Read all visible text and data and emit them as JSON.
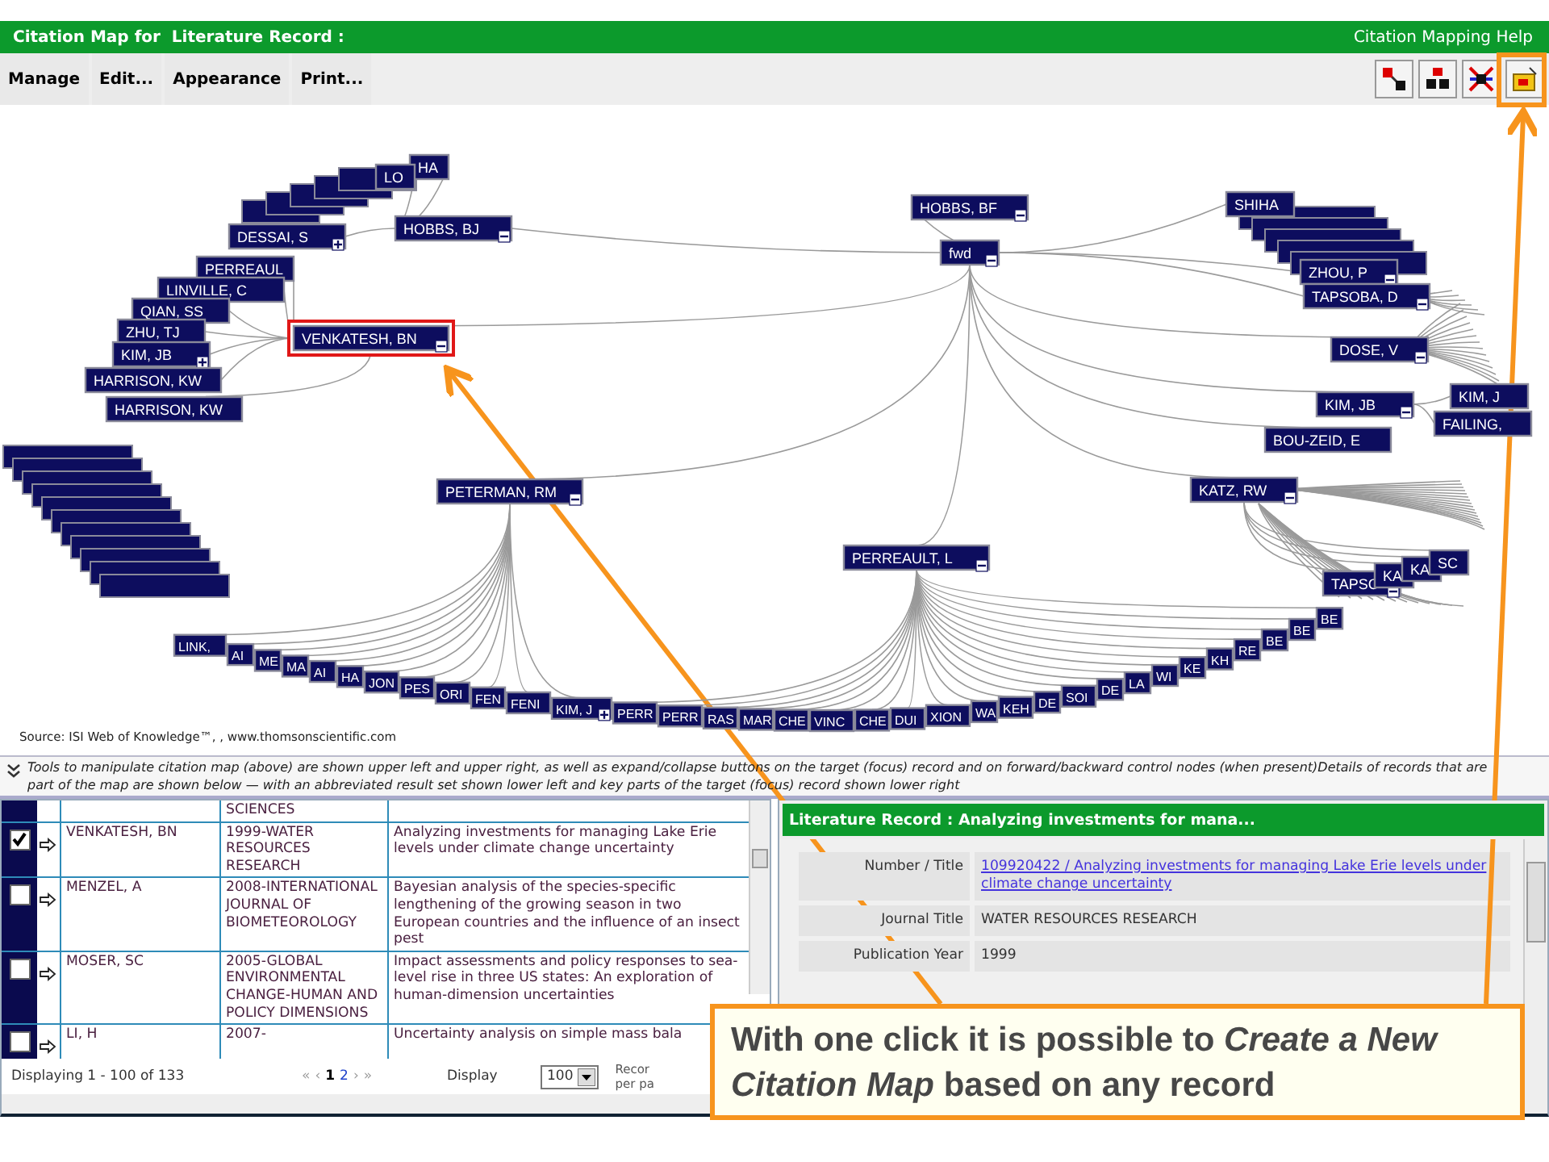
{
  "title_bar": {
    "title": "Citation Map for  Literature Record :",
    "help": "Citation Mapping Help"
  },
  "menu": [
    "Manage",
    "Edit...",
    "Appearance",
    "Print..."
  ],
  "toolbar": [
    {
      "kind": "link"
    },
    {
      "kind": "cluster"
    },
    {
      "kind": "cross"
    },
    {
      "kind": "new_map"
    }
  ],
  "map": {
    "source": "Source: ISI Web of Knowledge™, , www.thomsonscientific.com",
    "root": {
      "label": "fwd",
      "expanded": true,
      "selected": false,
      "children": [
        {
          "label": "HOBBS, BJ",
          "expanded": true,
          "selected": false,
          "children": [
            {
              "label": "HA",
              "selected": false
            },
            {
              "label": "LO",
              "selected": false
            },
            {
              "label": "DESSAI, S",
              "expanded": false,
              "selected": false
            }
          ]
        },
        {
          "label": "HOBBS, BF",
          "expanded": true,
          "selected": false
        },
        {
          "label": "VENKATESH, BN",
          "expanded": true,
          "selected": true,
          "children": [
            {
              "label": "PERREAUL",
              "selected": false
            },
            {
              "label": "LINVILLE, C",
              "selected": false
            },
            {
              "label": "QIAN, SS",
              "selected": false
            },
            {
              "label": "ZHU, TJ",
              "selected": false
            },
            {
              "label": "KIM, JB",
              "expanded": false,
              "selected": false
            },
            {
              "label": "HARRISON, KW",
              "selected": false
            },
            {
              "label": "HARRISON, KW",
              "selected": false
            }
          ]
        },
        {
          "label": "PETERMAN, RM",
          "expanded": true,
          "selected": false,
          "children": [
            {
              "label": "LINK,",
              "selected": false
            },
            {
              "label": "AI",
              "selected": false
            },
            {
              "label": "ME",
              "selected": false
            },
            {
              "label": "MA",
              "selected": false
            },
            {
              "label": "AI",
              "selected": false
            },
            {
              "label": "HA",
              "selected": false
            },
            {
              "label": "JON",
              "selected": false
            },
            {
              "label": "PES",
              "selected": false
            },
            {
              "label": "ORI",
              "selected": false
            },
            {
              "label": "FEN",
              "selected": false
            },
            {
              "label": "FENI",
              "selected": false
            },
            {
              "label": "KIM, J",
              "expanded": false,
              "selected": false
            }
          ]
        },
        {
          "label": "PERREAULT, L",
          "expanded": true,
          "selected": false,
          "children": [
            {
              "label": "PERR",
              "selected": false
            },
            {
              "label": "PERR",
              "selected": false
            },
            {
              "label": "RAS",
              "selected": false
            },
            {
              "label": "MAR",
              "selected": false
            },
            {
              "label": "CHE",
              "selected": false
            },
            {
              "label": "VINC",
              "selected": false
            },
            {
              "label": "CHE",
              "selected": false
            },
            {
              "label": "DUI",
              "selected": false
            },
            {
              "label": "XION",
              "selected": false
            },
            {
              "label": "WA",
              "selected": false
            },
            {
              "label": "KEH",
              "selected": false
            },
            {
              "label": "DE",
              "selected": false
            },
            {
              "label": "SOI",
              "selected": false
            },
            {
              "label": "DE",
              "selected": false
            },
            {
              "label": "LA",
              "selected": false
            },
            {
              "label": "WI",
              "selected": false
            },
            {
              "label": "KE",
              "selected": false
            },
            {
              "label": "KH",
              "selected": false
            },
            {
              "label": "RE",
              "selected": false
            },
            {
              "label": "BE",
              "selected": false
            },
            {
              "label": "BE",
              "selected": false
            },
            {
              "label": "BE",
              "selected": false
            }
          ]
        },
        {
          "label": "SHIHA",
          "selected": false
        },
        {
          "label": "ZHOU, P",
          "expanded": true,
          "selected": false
        },
        {
          "label": "TAPSOBA, D",
          "expanded": true,
          "selected": false
        },
        {
          "label": "DOSE, V",
          "expanded": true,
          "selected": false
        },
        {
          "label": "KIM, JB",
          "expanded": true,
          "selected": false,
          "children": [
            {
              "label": "KIM, J",
              "selected": false
            },
            {
              "label": "FAILING,",
              "selected": false
            }
          ]
        },
        {
          "label": "BOU-ZEID, E",
          "selected": false
        },
        {
          "label": "KATZ, RW",
          "expanded": true,
          "selected": false,
          "children": [
            {
              "label": "TAPSC",
              "expanded": true,
              "selected": false
            },
            {
              "label": "KA",
              "selected": false
            },
            {
              "label": "KA",
              "selected": false
            },
            {
              "label": "SC",
              "selected": false
            }
          ]
        }
      ]
    }
  },
  "info": "Tools to manipulate citation map (above) are shown upper left and upper right, as well as expand/collapse buttons on the target (focus) record and on forward/backward control nodes (when present)Details of records that are part of the map are shown below — with an abbreviated result set shown lower left and key parts of the target (focus) record shown lower right",
  "results": {
    "top_cut_cell": "SCIENCES",
    "rows": [
      {
        "checked": true,
        "author": "VENKATESH, BN",
        "source": "1999-WATER RESOURCES RESEARCH",
        "title": "Analyzing investments for managing Lake Erie levels under climate change uncertainty"
      },
      {
        "checked": false,
        "author": "MENZEL, A",
        "source": "2008-INTERNATIONAL JOURNAL OF BIOMETEOROLOGY",
        "title": "Bayesian analysis of the species-specific lengthening of the growing season in two European countries and the influence of an insect pest"
      },
      {
        "checked": false,
        "author": "MOSER, SC",
        "source": "2005-GLOBAL ENVIRONMENTAL CHANGE-HUMAN AND POLICY DIMENSIONS",
        "title": "Impact assessments and policy responses to sea-level rise in three US states: An exploration of human-dimension uncertainties"
      },
      {
        "checked": false,
        "author": "LI, H",
        "source": "2007-",
        "title": "Uncertainty analysis on simple mass bala"
      }
    ],
    "status": "Displaying 1 - 100 of 133",
    "pager": {
      "first": "«",
      "prev": "‹",
      "pages": [
        {
          "label": "1",
          "selected": true
        },
        {
          "label": "2",
          "selected": false
        }
      ],
      "next": "›",
      "last": "»"
    },
    "display_label": "Display",
    "per_page": "100",
    "per_page_label": "Recor per pa"
  },
  "record": {
    "header": "Literature Record : Analyzing investments for mana...",
    "fields": [
      {
        "kind": "link",
        "label": "Number / Title",
        "value": "109920422 / Analyzing investments for managing Lake Erie levels under climate change uncertainty"
      },
      {
        "kind": "text",
        "label": "Journal Title",
        "value": "WATER RESOURCES RESEARCH"
      },
      {
        "kind": "text",
        "label": "Publication Year",
        "value": "1999"
      }
    ]
  },
  "callout": "With one click it is possible to *Create a New Citation Map* based on any record"
}
